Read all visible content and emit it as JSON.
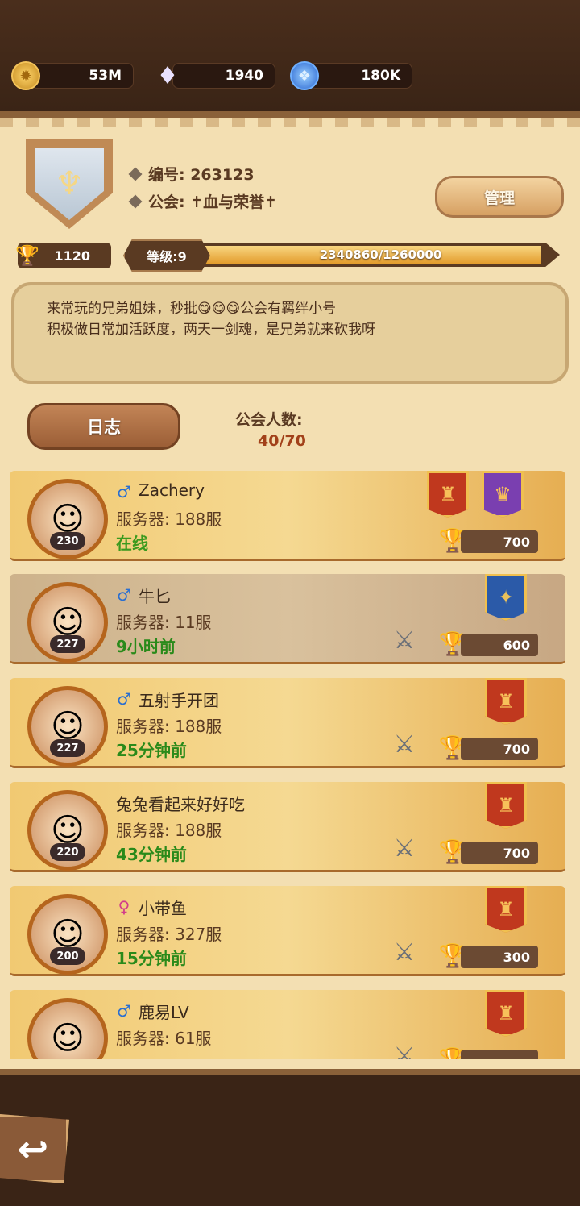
{
  "resources": {
    "gold": "53M",
    "diamond": "1940",
    "gem": "180K"
  },
  "guild": {
    "id_label": "编号: 263123",
    "name_label": "公会: ✝血与荣誉✝",
    "manage_label": "管理",
    "trophies": "1120",
    "level_label": "等级:9",
    "xp_text": "2340860/1260000",
    "xp_fraction": 1.0,
    "notice_line1": "来常玩的兄弟姐妹，秒批😋😋😋公会有羁绊小号",
    "notice_line2": "积极做日常加活跃度，两天一剑魂，是兄弟就来砍我呀",
    "log_label": "日志",
    "member_count_label": "公会人数:",
    "member_count": "40/70"
  },
  "members": [
    {
      "gender": "♂",
      "name": "Zachery",
      "server": "服务器: 188服",
      "status": "在线",
      "level": "230",
      "score": "700",
      "banners": [
        "red",
        "purple"
      ],
      "swords": false
    },
    {
      "gender": "♂",
      "name": "牛匕",
      "server": "服务器: 11服",
      "status": "9小时前",
      "level": "227",
      "score": "600",
      "banners": [
        "blue"
      ],
      "swords": true
    },
    {
      "gender": "♂",
      "name": "五射手开团",
      "server": "服务器: 188服",
      "status": "25分钟前",
      "level": "227",
      "score": "700",
      "banners": [
        "red"
      ],
      "swords": true
    },
    {
      "gender": "",
      "name": "兔兔看起来好好吃",
      "server": "服务器: 188服",
      "status": "43分钟前",
      "level": "220",
      "score": "700",
      "banners": [
        "red"
      ],
      "swords": true
    },
    {
      "gender": "♀",
      "name": "小带鱼",
      "server": "服务器: 327服",
      "status": "15分钟前",
      "level": "200",
      "score": "300",
      "banners": [
        "red"
      ],
      "swords": true
    },
    {
      "gender": "♂",
      "name": "鹿易LV",
      "server": "服务器: 61服",
      "status": "",
      "level": "",
      "score": "",
      "banners": [
        "red"
      ],
      "swords": true
    }
  ],
  "icons": {
    "gold": "gold-coin-icon",
    "diamond": "diamond-icon",
    "gem": "blue-gem-icon",
    "trophy": "trophy-icon",
    "swords": "crossed-swords-icon",
    "back": "back-arrow-icon"
  }
}
